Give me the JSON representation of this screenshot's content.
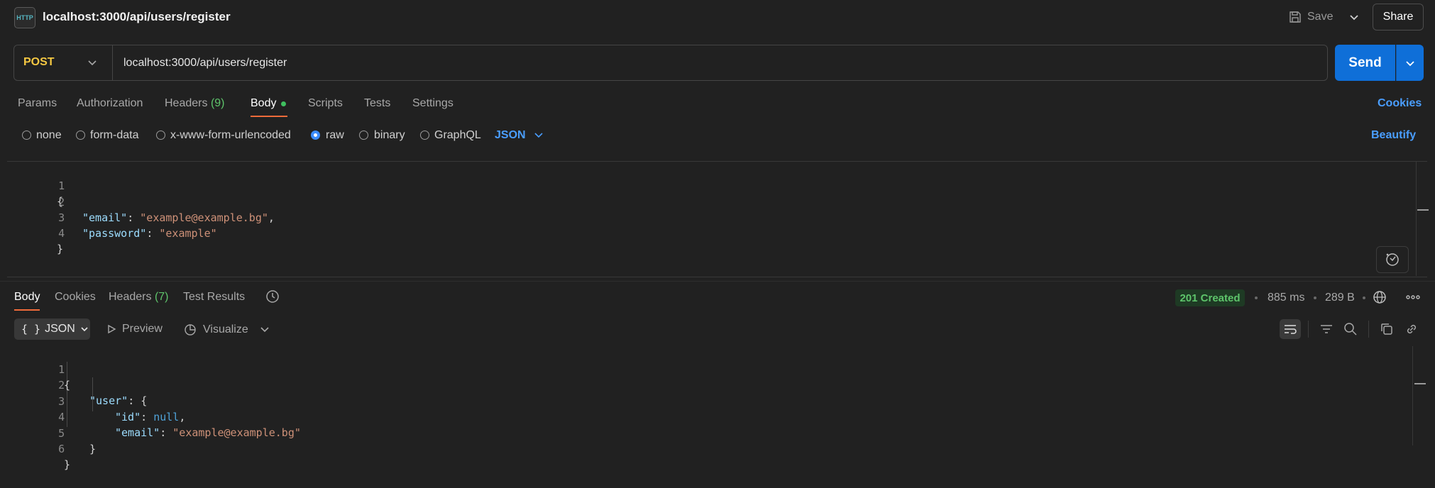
{
  "header": {
    "icon_text": "HTTP",
    "title": "localhost:3000/api/users/register",
    "save_label": "Save",
    "share_label": "Share"
  },
  "request": {
    "method": "POST",
    "url": "localhost:3000/api/users/register",
    "send_label": "Send"
  },
  "tabs": {
    "params": "Params",
    "authorization": "Authorization",
    "headers": "Headers",
    "headers_count": "(9)",
    "body": "Body",
    "scripts": "Scripts",
    "tests": "Tests",
    "settings": "Settings",
    "cookies": "Cookies"
  },
  "body_types": {
    "none": "none",
    "form_data": "form-data",
    "urlencoded": "x-www-form-urlencoded",
    "raw": "raw",
    "binary": "binary",
    "graphql": "GraphQL",
    "selected": "raw",
    "language": "JSON",
    "beautify": "Beautify"
  },
  "request_body": {
    "line_numbers": [
      "1",
      "2",
      "3",
      "4"
    ],
    "open_brace": "{",
    "close_brace": "}",
    "email_key": "\"email\"",
    "email_value": "\"example@example.bg\"",
    "password_key": "\"password\"",
    "password_value": "\"example\""
  },
  "response": {
    "tabs": {
      "body": "Body",
      "cookies": "Cookies",
      "headers": "Headers",
      "headers_count": "(7)",
      "test_results": "Test Results"
    },
    "status": "201 Created",
    "time": "885 ms",
    "size": "289 B",
    "format": "JSON",
    "preview": "Preview",
    "visualize": "Visualize",
    "line_numbers": [
      "1",
      "2",
      "3",
      "4",
      "5",
      "6"
    ],
    "open_brace": "{",
    "close_brace": "}",
    "user_key": "\"user\"",
    "id_key": "\"id\"",
    "id_value": "null",
    "email_key": "\"email\"",
    "email_value": "\"example@example.bg\""
  },
  "colors": {
    "accent": "#0f6fd8",
    "method": "#f5c842",
    "tab_underline": "#ef6b3a",
    "status": "#5ec46b",
    "link": "#4a9eff"
  }
}
